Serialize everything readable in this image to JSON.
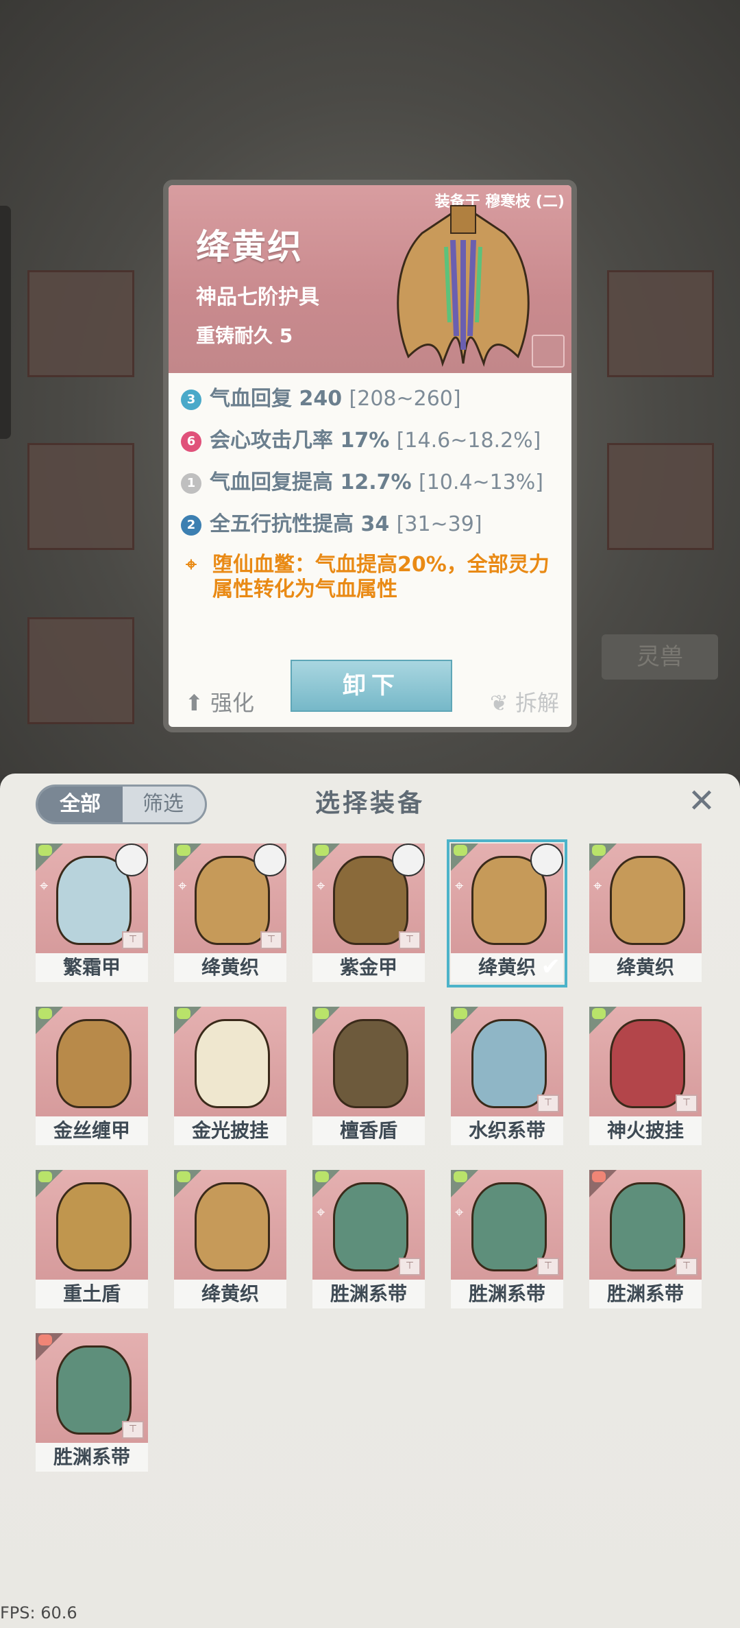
{
  "background": {
    "side_tab_label": "灵兽"
  },
  "detail_card": {
    "equipped_on": "装备于 穆寒枝 (二)",
    "item_name": "绛黄织",
    "grade": "神品七阶护具",
    "durability": "重铸耐久 5",
    "stats": [
      {
        "badge": "3",
        "text": "气血回复 240",
        "range": "[208~260]",
        "badge_color": "#4aa9c9"
      },
      {
        "badge": "6",
        "text": "会心攻击几率 17%",
        "range": "[14.6~18.2%]",
        "badge_color": "#e0517a"
      },
      {
        "badge": "1",
        "text": "气血回复提高 12.7%",
        "range": "[10.4~13%]",
        "badge_color": "#bfbfbf"
      },
      {
        "badge": "2",
        "text": "全五行抗性提高 34",
        "range": "[31~39]",
        "badge_color": "#3c7fb1"
      }
    ],
    "special": {
      "badge": "⌖",
      "text": "堕仙血鳖：气血提高20%，全部灵力属性转化为气血属性"
    },
    "strengthen_label": "强化",
    "unequip_label": "卸下",
    "dismantle_label": "拆解"
  },
  "sheet": {
    "title": "选择装备",
    "filter_all": "全部",
    "filter_filter": "筛选",
    "close_icon": "close-icon"
  },
  "items": [
    {
      "name": "繁霜甲",
      "tier": "green",
      "locked": true,
      "avatar": true,
      "bound": true,
      "selected": false,
      "color": "#b8d3dc"
    },
    {
      "name": "绛黄织",
      "tier": "green",
      "locked": true,
      "avatar": true,
      "bound": true,
      "selected": false,
      "color": "#c69a59"
    },
    {
      "name": "紫金甲",
      "tier": "green",
      "locked": true,
      "avatar": true,
      "bound": true,
      "selected": false,
      "color": "#8a6a3a"
    },
    {
      "name": "绛黄织",
      "tier": "green",
      "locked": true,
      "avatar": true,
      "bound": false,
      "selected": true,
      "color": "#c69a59"
    },
    {
      "name": "绛黄织",
      "tier": "green",
      "locked": true,
      "avatar": false,
      "bound": false,
      "selected": false,
      "color": "#c69a59"
    },
    {
      "name": "金丝缠甲",
      "tier": "green",
      "locked": false,
      "avatar": false,
      "bound": false,
      "selected": false,
      "color": "#b88a4a"
    },
    {
      "name": "金光披挂",
      "tier": "green",
      "locked": false,
      "avatar": false,
      "bound": false,
      "selected": false,
      "color": "#efe7cf"
    },
    {
      "name": "檀香盾",
      "tier": "green",
      "locked": false,
      "avatar": false,
      "bound": false,
      "selected": false,
      "color": "#6d5a3c"
    },
    {
      "name": "水织系带",
      "tier": "green",
      "locked": false,
      "avatar": false,
      "bound": true,
      "selected": false,
      "color": "#8fb6c6"
    },
    {
      "name": "神火披挂",
      "tier": "green",
      "locked": false,
      "avatar": false,
      "bound": true,
      "selected": false,
      "color": "#b3454a"
    },
    {
      "name": "重土盾",
      "tier": "green",
      "locked": false,
      "avatar": false,
      "bound": false,
      "selected": false,
      "color": "#c0964e"
    },
    {
      "name": "绛黄织",
      "tier": "green",
      "locked": false,
      "avatar": false,
      "bound": false,
      "selected": false,
      "color": "#c69a59"
    },
    {
      "name": "胜渊系带",
      "tier": "green",
      "locked": true,
      "avatar": false,
      "bound": true,
      "selected": false,
      "color": "#5e8f7b"
    },
    {
      "name": "胜渊系带",
      "tier": "green",
      "locked": true,
      "avatar": false,
      "bound": true,
      "selected": false,
      "color": "#5e8f7b"
    },
    {
      "name": "胜渊系带",
      "tier": "red",
      "locked": false,
      "avatar": false,
      "bound": true,
      "selected": false,
      "color": "#5e8f7b"
    },
    {
      "name": "胜渊系带",
      "tier": "red",
      "locked": false,
      "avatar": false,
      "bound": true,
      "selected": false,
      "color": "#5e8f7b"
    }
  ],
  "fps": "FPS: 60.6"
}
